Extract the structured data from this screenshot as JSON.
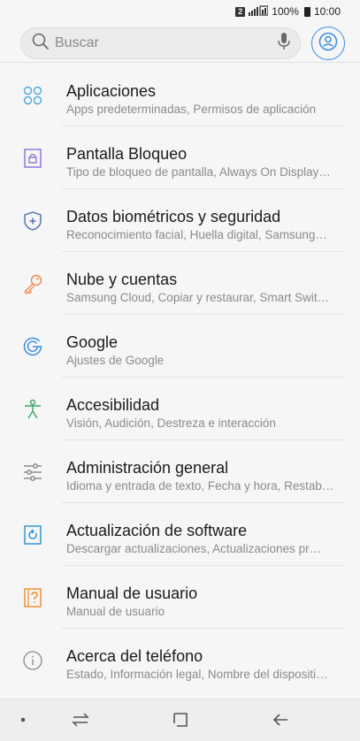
{
  "status_bar": {
    "notification_badge": "2",
    "battery_percent": "100%",
    "time": "10:00"
  },
  "search": {
    "placeholder": "Buscar"
  },
  "settings_items": [
    {
      "icon": "apps-icon",
      "title": "Aplicaciones",
      "subtitle": "Apps predeterminadas, Permisos de aplicación"
    },
    {
      "icon": "lock-screen-icon",
      "title": "Pantalla Bloqueo",
      "subtitle": "Tipo de bloqueo de pantalla, Always On Display…"
    },
    {
      "icon": "shield-icon",
      "title": "Datos biométricos y seguridad",
      "subtitle": "Reconocimiento facial, Huella digital, Samsung…"
    },
    {
      "icon": "key-icon",
      "title": "Nube y cuentas",
      "subtitle": "Samsung Cloud, Copiar y restaurar, Smart Swit…"
    },
    {
      "icon": "google-icon",
      "title": "Google",
      "subtitle": "Ajustes de Google"
    },
    {
      "icon": "accessibility-icon",
      "title": "Accesibilidad",
      "subtitle": "Visión, Audición, Destreza e interacción"
    },
    {
      "icon": "sliders-icon",
      "title": "Administración general",
      "subtitle": "Idioma y entrada de texto, Fecha y hora, Restab…"
    },
    {
      "icon": "software-update-icon",
      "title": "Actualización de software",
      "subtitle": "Descargar actualizaciones, Actualizaciones pr…"
    },
    {
      "icon": "user-manual-icon",
      "title": "Manual de usuario",
      "subtitle": "Manual de usuario"
    },
    {
      "icon": "info-icon",
      "title": "Acerca del teléfono",
      "subtitle": "Estado, Información legal, Nombre del dispositi…"
    }
  ],
  "nav_bar": {
    "buttons": [
      "dot-icon",
      "recents-icon",
      "home-icon",
      "back-icon"
    ]
  },
  "colors": {
    "accent_blue": "#3b8de0",
    "apps": "#46a8e0",
    "lock": "#8a6fd6",
    "shield": "#4a6bb0",
    "key": "#f08a4b",
    "google": "#3c8ce7",
    "accessibility": "#3aa46b",
    "sliders": "#7a7a7a",
    "update": "#2a8fd6",
    "manual": "#f08a2b",
    "info": "#8a8a8a"
  }
}
